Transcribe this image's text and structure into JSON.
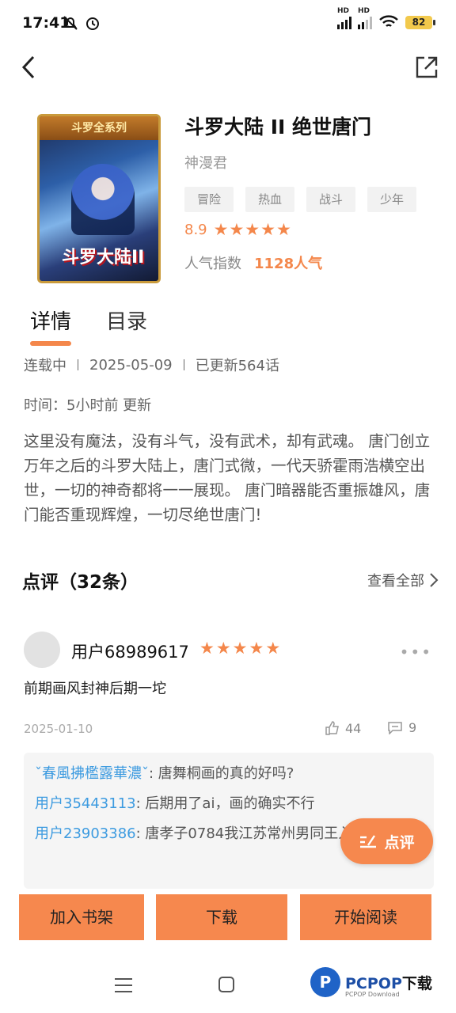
{
  "status_bar": {
    "time": "17:41",
    "battery": "82",
    "signal_label_1": "HD",
    "signal_label_2": "HD"
  },
  "book": {
    "cover_series": "斗罗全系列",
    "cover_logo": "斗罗大陆II",
    "title": "斗罗大陆 II 绝世唐门",
    "author": "神漫君",
    "tags": [
      "冒险",
      "热血",
      "战斗",
      "少年"
    ],
    "rating": "8.9",
    "rating_stars": 5,
    "popularity_label": "人气指数",
    "popularity_value": "1128人气"
  },
  "tabs": {
    "details": "详情",
    "catalog": "目录"
  },
  "details": {
    "status": "连载中",
    "date": "2025-05-09",
    "updated": "已更新564话",
    "time": "时间：5小时前 更新",
    "description": "这里没有魔法，没有斗气，没有武术，却有武魂。 唐门创立万年之后的斗罗大陆上，唐门式微，一代天骄霍雨浩横空出世，一切的神奇都将一一展现。 唐门暗器能否重振雄风，唐门能否重现辉煌，一切尽绝世唐门!"
  },
  "reviews": {
    "title": "点评（32条）",
    "view_all": "查看全部",
    "item": {
      "username": "用户68989617",
      "stars": 5,
      "text": "前期画风封神后期一坨",
      "date": "2025-01-10",
      "likes": "44",
      "comments": "9",
      "replies": [
        {
          "user": "ˇ春風拂檻露華濃ˇ",
          "text": ": 唐舞桐画的真的好吗?"
        },
        {
          "user": "用户35443113",
          "text": ": 后期用了ai，画的确实不行"
        },
        {
          "user": "用户23903386",
          "text": ": 唐孝子0784我江苏常州男同王入后你"
        }
      ]
    }
  },
  "fab_label": "点评",
  "actions": {
    "add_shelf": "加入书架",
    "download": "下载",
    "start_reading": "开始阅读"
  },
  "watermark": {
    "logo": "P",
    "text": "PCPOP",
    "text_suffix": "下载",
    "sub": "PCPOP Download"
  },
  "colors": {
    "accent": "#f6884e",
    "link": "#3d9be0"
  }
}
